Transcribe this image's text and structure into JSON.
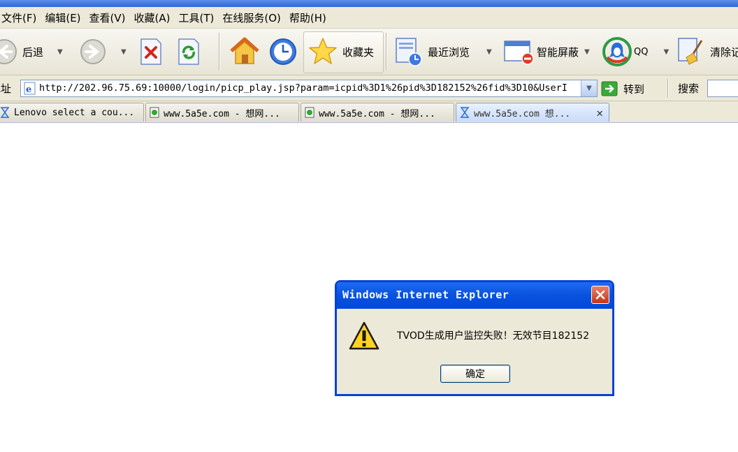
{
  "menu": [
    "文件(F)",
    "编辑(E)",
    "查看(V)",
    "收藏(A)",
    "工具(T)",
    "在线服务(O)",
    "帮助(H)"
  ],
  "toolbar": {
    "back_label": "后退",
    "favorites_label": "收藏夹",
    "history_label": "最近浏览",
    "popup_blocker_label": "智能屏蔽",
    "qq_label": "QQ",
    "clear_label": "清除记"
  },
  "address": {
    "label": "地址",
    "url": "http://202.96.75.69:10000/login/picp_play.jsp?param=icpid%3D1%26pid%3D182152%26fid%3D10&UserI",
    "go_label": "转到",
    "search_label": "搜索"
  },
  "tabs": [
    {
      "title": "Lenovo select a cou...",
      "icon": "hourglass-icon",
      "active": false
    },
    {
      "title": "www.5a5e.com - 想网...",
      "icon": "page-icon",
      "active": false
    },
    {
      "title": "www.5a5e.com - 想网...",
      "icon": "page-icon",
      "active": false
    },
    {
      "title": "www.5a5e.com 想...",
      "icon": "hourglass-icon",
      "active": true
    }
  ],
  "dialog": {
    "title": "Windows Internet Explorer",
    "message": "TVOD生成用户监控失败！无效节目182152",
    "ok_label": "确定",
    "icon": "warning-icon"
  },
  "colors": {
    "chrome": "#ece9d8",
    "dialog_title": "#0a54e0",
    "dialog_close": "#c6341a"
  }
}
